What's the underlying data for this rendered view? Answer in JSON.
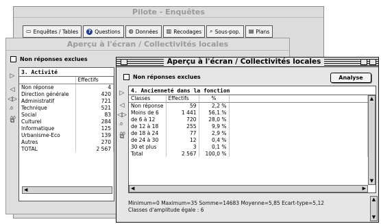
{
  "pilot": {
    "title": "Pilote - Enquêtes",
    "tabs": [
      {
        "label": "Enquêtes / Tables"
      },
      {
        "label": "Questions"
      },
      {
        "label": "Données"
      },
      {
        "label": "Recodages"
      },
      {
        "label": "Sous-pop."
      },
      {
        "label": "Plans"
      }
    ]
  },
  "back_window": {
    "title": "Aperçu à l'écran / Collectivités locales",
    "checkbox_label": "Non réponses exclues",
    "table_title": "3. Activité",
    "column_header": "Effectifs",
    "rows": [
      {
        "label": "Non réponse",
        "value": "4"
      },
      {
        "label": "Direction générale",
        "value": "420"
      },
      {
        "label": "Administratif",
        "value": "721"
      },
      {
        "label": "Technique",
        "value": "521"
      },
      {
        "label": "Social",
        "value": "83"
      },
      {
        "label": "Culturel",
        "value": "284"
      },
      {
        "label": "Informatique",
        "value": "125"
      },
      {
        "label": "Urbanisme-Eco",
        "value": "139"
      },
      {
        "label": "Autres",
        "value": "270"
      },
      {
        "label": "TOTAL",
        "value": "2 567"
      }
    ]
  },
  "front_window": {
    "title": "Aperçu à l'écran / Collectivités locales",
    "checkbox_label": "Non réponses exclues",
    "analyse_label": "Analyse",
    "table_title": "4. Ancienneté dans la fonction",
    "headers": [
      "Classes",
      "Effectifs",
      "%"
    ],
    "rows": [
      {
        "classe": "Non réponse",
        "effectif": "59",
        "pct": "2,2 %"
      },
      {
        "classe": "Moins de 6",
        "effectif": "1 441",
        "pct": "56,1 %"
      },
      {
        "classe": "de 6 à 12",
        "effectif": "720",
        "pct": "28,0 %"
      },
      {
        "classe": "de 12 à 18",
        "effectif": "255",
        "pct": "9,9 %"
      },
      {
        "classe": "de 18 à 24",
        "effectif": "77",
        "pct": "2,9 %"
      },
      {
        "classe": "de 24 à 30",
        "effectif": "12",
        "pct": "0,4 %"
      },
      {
        "classe": "30 et plus",
        "effectif": "3",
        "pct": "0,1 %"
      },
      {
        "classe": "Total",
        "effectif": "2 567",
        "pct": "100,0 %"
      }
    ],
    "stats_line1": "Minimum=0  Maximum=35  Somme=14683  Moyenne=5,85  Ecart-type=5,12",
    "stats_line2": "Classes d'amplitude égale : 6"
  }
}
